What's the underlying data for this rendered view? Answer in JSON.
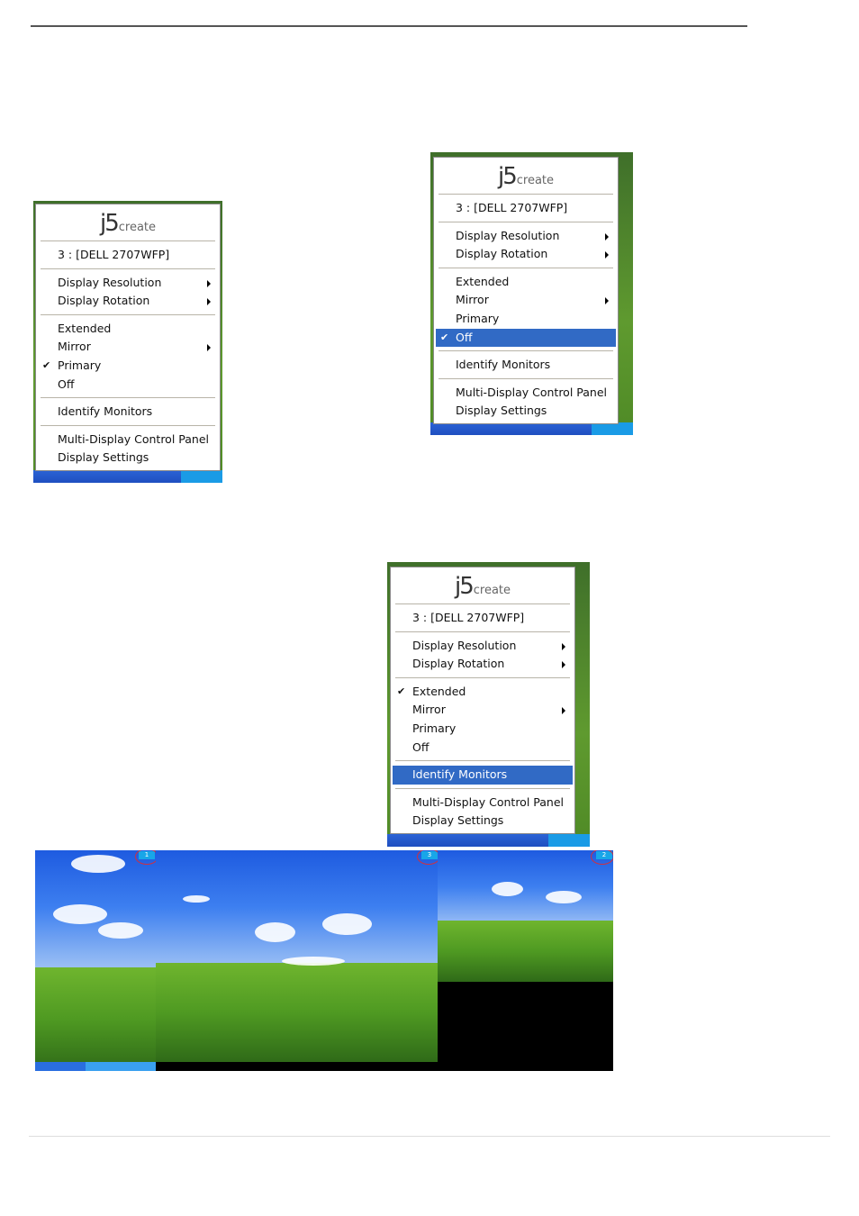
{
  "logo": {
    "main": "j5",
    "sub": "create"
  },
  "menus": [
    {
      "name": "menu-primary",
      "header": "3 : [DELL 2707WFP]",
      "groups": [
        [
          {
            "label": "Display Resolution",
            "submenu": true
          },
          {
            "label": "Display Rotation",
            "submenu": true
          }
        ],
        [
          {
            "label": "Extended"
          },
          {
            "label": "Mirror",
            "submenu": true
          },
          {
            "label": "Primary",
            "checked": true
          },
          {
            "label": "Off"
          }
        ],
        [
          {
            "label": "Identify Monitors"
          }
        ],
        [
          {
            "label": "Multi-Display Control Panel"
          },
          {
            "label": "Display Settings"
          }
        ]
      ]
    },
    {
      "name": "menu-off",
      "header": "3 : [DELL 2707WFP]",
      "groups": [
        [
          {
            "label": "Display Resolution",
            "submenu": true
          },
          {
            "label": "Display Rotation",
            "submenu": true
          }
        ],
        [
          {
            "label": "Extended"
          },
          {
            "label": "Mirror",
            "submenu": true
          },
          {
            "label": "Primary"
          },
          {
            "label": "Off",
            "checked": true,
            "highlighted": true
          }
        ],
        [
          {
            "label": "Identify Monitors"
          }
        ],
        [
          {
            "label": "Multi-Display Control Panel"
          },
          {
            "label": "Display Settings"
          }
        ]
      ]
    },
    {
      "name": "menu-identify",
      "header": "3 : [DELL 2707WFP]",
      "groups": [
        [
          {
            "label": "Display Resolution",
            "submenu": true
          },
          {
            "label": "Display Rotation",
            "submenu": true
          }
        ],
        [
          {
            "label": "Extended",
            "checked": true
          },
          {
            "label": "Mirror",
            "submenu": true
          },
          {
            "label": "Primary"
          },
          {
            "label": "Off"
          }
        ],
        [
          {
            "label": "Identify Monitors",
            "highlighted": true
          }
        ],
        [
          {
            "label": "Multi-Display Control Panel"
          },
          {
            "label": "Display Settings"
          }
        ]
      ]
    }
  ],
  "monitor_badges": [
    "1",
    "3",
    "2"
  ],
  "colors": {
    "highlight": "#316ac5",
    "badge": "#18a6e8",
    "ring": "#d03040"
  }
}
